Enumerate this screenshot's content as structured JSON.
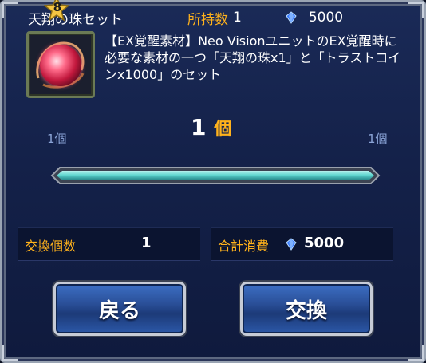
{
  "header": {
    "item_name": "天翔の珠セット",
    "owned_label": "所持数",
    "owned_value": "1",
    "gems": "5000",
    "gem_icon": "blue-gem-icon"
  },
  "item": {
    "icon": "red-orb-icon",
    "star_level": "8",
    "description": "【EX覚醒素材】Neo VisionユニットのEX覚醒時に必要な素材の一つ「天翔の珠x1」と「トラストコインx1000」のセット"
  },
  "quantity": {
    "min_label": "1個",
    "max_label": "1個",
    "current": "1",
    "unit": "個",
    "slider_fraction": 1.0
  },
  "summary": {
    "count_label": "交換個数",
    "count_value": "1",
    "total_label": "合計消費",
    "total_value": "5000"
  },
  "buttons": {
    "back": "戻る",
    "exchange": "交換"
  },
  "colors": {
    "accent_orange": "#ffb21c",
    "slider_teal": "#5fd6cf",
    "button_blue": "#2a4f98"
  }
}
